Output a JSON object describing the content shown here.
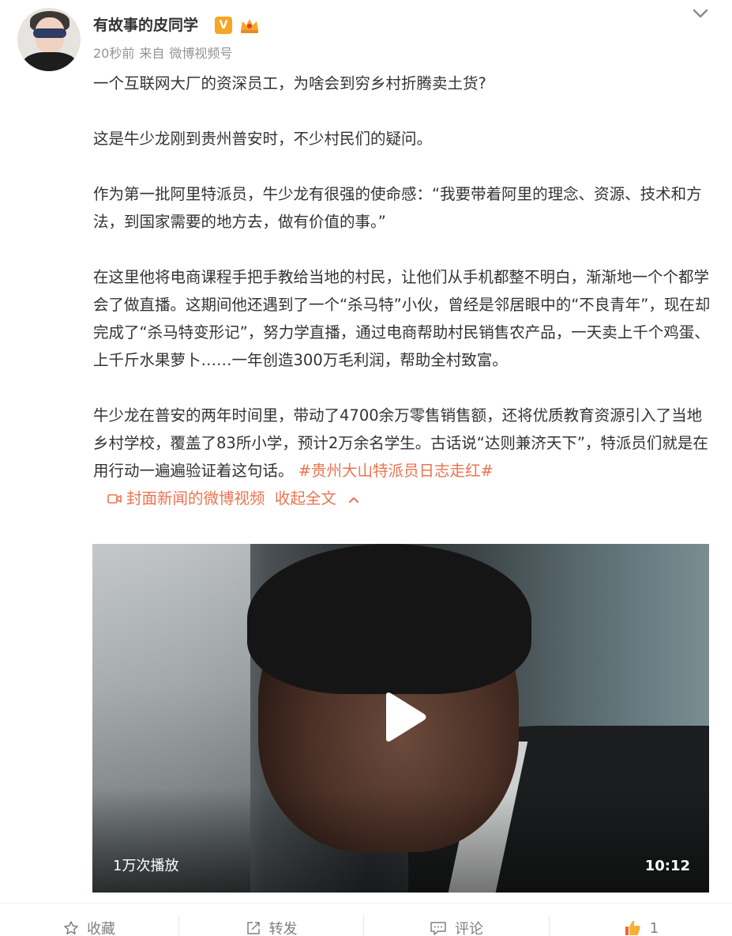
{
  "header": {
    "username": "有故事的皮同学",
    "vip_label": "V",
    "time": "20秒前",
    "source_prefix": "来自",
    "source": "微博视频号"
  },
  "post": {
    "p1": "一个互联网大厂的资深员工，为啥会到穷乡村折腾卖土货?",
    "p2": "这是牛少龙刚到贵州普安时，不少村民们的疑问。",
    "p3": "作为第一批阿里特派员，牛少龙有很强的使命感：“我要带着阿里的理念、资源、技术和方法，到国家需要的地方去，做有价值的事。”",
    "p4": "在这里他将电商课程手把手教给当地的村民，让他们从手机都整不明白，渐渐地一个个都学会了做直播。这期间他还遇到了一个“杀马特”小伙，曾经是邻居眼中的“不良青年”，现在却完成了“杀马特变形记”，努力学直播，通过电商帮助村民销售农产品，一天卖上千个鸡蛋、上千斤水果萝卜……一年创造300万毛利润，帮助全村致富。",
    "p5": "牛少龙在普安的两年时间里，带动了4700余万零售销售额，还将优质教育资源引入了当地乡村学校，覆盖了83所小学，预计2万余名学生。古话说“达则兼济天下”，特派员们就是在用行动一遍遍验证着这句话。",
    "topic_tag": "#贵州大山特派员日志走红#",
    "video_link": "封面新闻的微博视频",
    "collapse": "收起全文"
  },
  "video": {
    "play_count": "1万次播放",
    "duration": "10:12"
  },
  "footer": {
    "favorite": "收藏",
    "repost": "转发",
    "comment": "评论",
    "like_count": "1"
  },
  "colors": {
    "link": "#eb7350",
    "muted": "#939393",
    "like": "#f5642a",
    "vip": "#f5a623"
  }
}
